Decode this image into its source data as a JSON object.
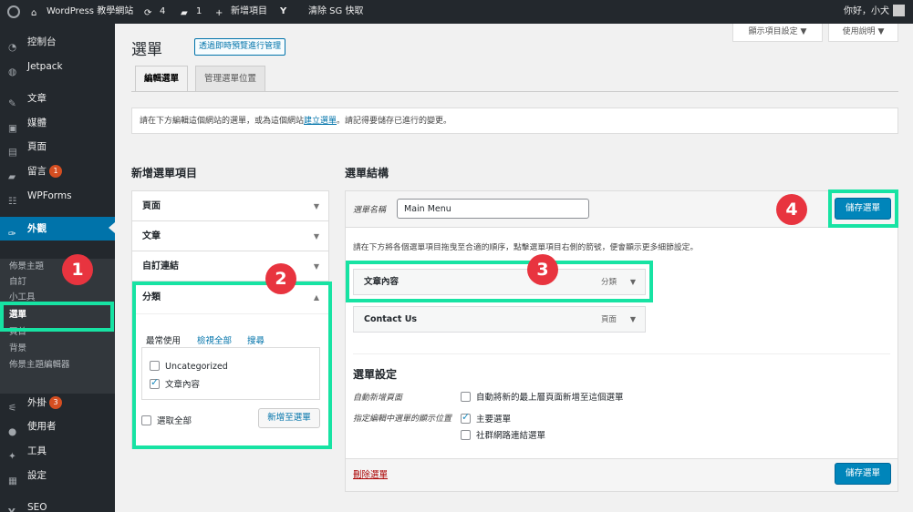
{
  "adminbar": {
    "site_title": "WordPress 教學網站",
    "updates_count": "4",
    "comments_count": "1",
    "new_label": "新增項目",
    "yoast_icon": "yoast-icon",
    "clear_cache": "清除 SG 快取",
    "greeting": "你好，小犬"
  },
  "sidebar": {
    "items": [
      {
        "label": "控制台",
        "icon": "dashboard-icon"
      },
      {
        "label": "Jetpack",
        "icon": "jetpack-icon"
      },
      {
        "label": "文章",
        "icon": "pin-icon"
      },
      {
        "label": "媒體",
        "icon": "media-icon"
      },
      {
        "label": "頁面",
        "icon": "page-icon"
      },
      {
        "label": "留言",
        "icon": "comment-icon",
        "badge": "1"
      },
      {
        "label": "WPForms",
        "icon": "forms-icon"
      },
      {
        "label": "外觀",
        "icon": "brush-icon"
      },
      {
        "label": "外掛",
        "icon": "plugin-icon",
        "badge": "3"
      },
      {
        "label": "使用者",
        "icon": "user-icon"
      },
      {
        "label": "工具",
        "icon": "wrench-icon"
      },
      {
        "label": "設定",
        "icon": "settings-icon"
      },
      {
        "label": "SEO",
        "icon": "yoast-icon"
      }
    ],
    "submenu": [
      "佈景主題",
      "自訂",
      "小工具",
      "選單",
      "頁首",
      "背景",
      "佈景主題編輯器"
    ]
  },
  "header": {
    "screen_options": "顯示項目設定 ▼",
    "help": "使用說明 ▼",
    "title": "選單",
    "live_preview": "透過即時預覽進行管理",
    "tabs": [
      "編輯選單",
      "管理選單位置"
    ]
  },
  "notice": {
    "before": "請在下方編輯這個網站的選單，或為這個網站",
    "link": "建立選單",
    "after": "。請記得要儲存已進行的變更。"
  },
  "add_items": {
    "heading": "新增選單項目",
    "sections": [
      "頁面",
      "文章",
      "自訂連結",
      "分類"
    ],
    "category_tabs": [
      "最常使用",
      "檢視全部",
      "搜尋"
    ],
    "categories": [
      {
        "label": "Uncategorized",
        "checked": false
      },
      {
        "label": "文章內容",
        "checked": true
      }
    ],
    "select_all": "選取全部",
    "add_button": "新增至選單"
  },
  "structure": {
    "heading": "選單結構",
    "name_label": "選單名稱",
    "name_value": "Main Menu",
    "save_button": "儲存選單",
    "instructions": "請在下方將各個選單項目拖曳至合適的順序，點擊選單項目右側的箭號，便會顯示更多細節設定。",
    "items": [
      {
        "title": "文章內容",
        "type": "分類"
      },
      {
        "title": "Contact Us",
        "type": "頁面"
      }
    ],
    "settings_heading": "選單設定",
    "auto_add_label": "自動新增頁面",
    "auto_add_option": "自動將新的最上層頁面新增至這個選單",
    "location_label": "指定編輯中選單的顯示位置",
    "locations": [
      {
        "label": "主要選單",
        "checked": true
      },
      {
        "label": "社群網路連結選單",
        "checked": false
      }
    ],
    "delete_link": "刪除選單"
  },
  "annotations": [
    "1",
    "2",
    "3",
    "4"
  ],
  "colors": {
    "accent": "#0073aa",
    "highlight": "#17e3a3",
    "marker": "#e8343f"
  }
}
